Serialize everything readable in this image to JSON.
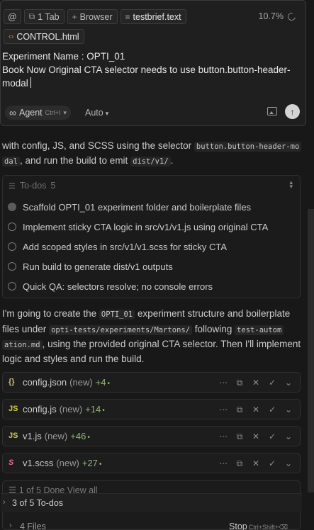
{
  "composer": {
    "chips": {
      "at": "@",
      "tab": "1 Tab",
      "browser": "Browser",
      "file": "testbrief.text"
    },
    "context_percent": "10.7%",
    "attached_file": "CONTROL.html",
    "prompt_line1": "Experiment Name : OPTI_01",
    "prompt_line2": "Book Now Original CTA selector needs to use button.button-header-modal",
    "mode": "Agent",
    "mode_shortcut": "Ctrl+I",
    "model": "Auto"
  },
  "message1": {
    "text_a": "with config, JS, and SCSS using the selector",
    "code_a": "button.button-header-modal",
    "code_a_l1": "button.button-header-mo",
    "code_a_l2": "dal",
    "text_b": ", and run the build to emit",
    "code_b": "dist/v1/",
    "text_c": "."
  },
  "todos": {
    "header": "To-dos",
    "count": "5",
    "items": [
      {
        "label": "Scaffold OPTI_01 experiment folder and boilerplate files",
        "active": true
      },
      {
        "label": "Implement sticky CTA logic in src/v1/v1.js using original CTA",
        "active": false
      },
      {
        "label": "Add scoped styles in src/v1/v1.scss for sticky CTA",
        "active": false
      },
      {
        "label": "Run build to generate dist/v1 outputs",
        "active": false
      },
      {
        "label": "Quick QA: selectors resolve; no console errors",
        "active": false
      }
    ]
  },
  "message2": {
    "p1": "I'm going to create the",
    "c1": "OPTI_01",
    "p2": "experiment structure and boilerplate",
    "p3": "files under",
    "c2": "opti-tests/experiments/Martons/",
    "p4": "following",
    "c3a": "test-autom",
    "c3b": "ation.md",
    "p5": ", using the provided original CTA selector. Then I'll implement",
    "p6": "logic and styles and run the build."
  },
  "files": [
    {
      "icon": "{}",
      "name": "config.json",
      "status": "(new)",
      "added": "+4"
    },
    {
      "icon": "JS",
      "name": "config.js",
      "status": "(new)",
      "added": "+14"
    },
    {
      "icon": "JS",
      "name": "v1.js",
      "status": "(new)",
      "added": "+46"
    },
    {
      "icon": "S",
      "name": "v1.scss",
      "status": "(new)",
      "added": "+27"
    }
  ],
  "bottom": {
    "progress_text": "1 of 5 Done  View all",
    "todos_summary": "3 of 5 To-dos",
    "files_summary": "4 Files",
    "stop_label": "Stop",
    "stop_shortcut": "Ctrl+Shift+⌫"
  },
  "colors": {
    "background": "#181818",
    "added": "#8fb77a",
    "json_icon": "#d7ba7d",
    "js_icon": "#cbcb41",
    "scss_icon": "#e06c9f",
    "html_icon": "#e07b39"
  }
}
